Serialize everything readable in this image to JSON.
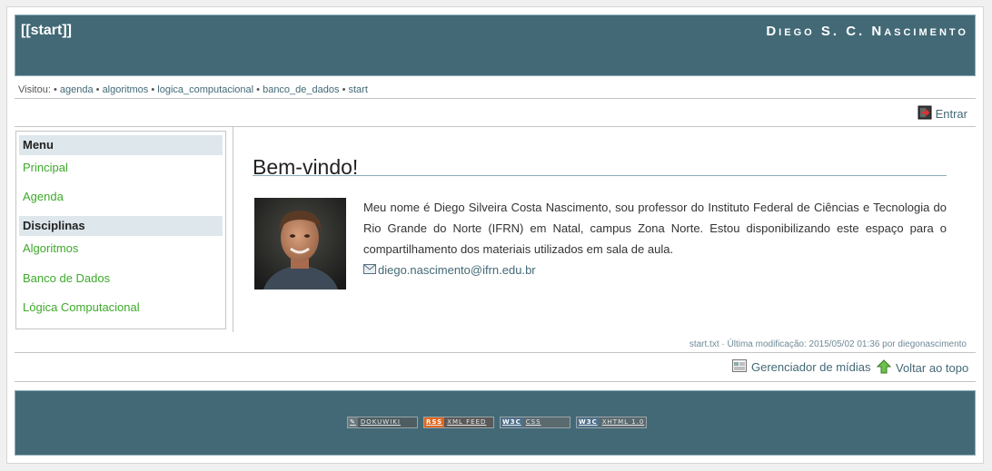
{
  "header": {
    "site_link": "[[start]]",
    "author_name": "Diego S. C. Nascimento"
  },
  "breadcrumbs": {
    "label": "Visitou:",
    "items": [
      "agenda",
      "algoritmos",
      "logica_computacional",
      "banco_de_dados",
      "start"
    ]
  },
  "user_tools": {
    "login": "Entrar"
  },
  "sidebar": {
    "menu_heading": "Menu",
    "menu_items": [
      "Principal",
      "Agenda"
    ],
    "disciplines_heading": "Disciplinas",
    "discipline_items": [
      "Algoritmos",
      "Banco de Dados",
      "Lógica Computacional"
    ]
  },
  "content": {
    "title": "Bem-vindo!",
    "intro": "Meu nome é Diego Silveira Costa Nascimento, sou professor do Instituto Federal de Ciências e Tecnologia do Rio Grande do Norte (IFRN) em Natal, campus Zona Norte. Estou disponibilizando este espaço para o compartilhamento dos materiais utilizados em sala de aula.",
    "email": "diego.nascimento@ifrn.edu.br"
  },
  "doc_info": "start.txt · Última modificação: 2015/05/02 01:36 por diegonascimento",
  "footer_tools": {
    "media_manager": "Gerenciador de mídias",
    "back_to_top": "Voltar ao topo"
  },
  "badges": [
    {
      "tag": "",
      "label": "DOKUWIKI"
    },
    {
      "tag": "RSS",
      "label": "XML FEED"
    },
    {
      "tag": "W3C",
      "label": "CSS"
    },
    {
      "tag": "W3C",
      "label": "XHTML 1.0"
    }
  ],
  "colors": {
    "header_bg": "#436976",
    "link": "#436976",
    "sidebar_link": "#3daa2a",
    "sidebar_heading_bg": "#dee7ec"
  },
  "icons": {
    "login": "login-icon",
    "email": "email-icon",
    "media_manager": "media-manager-icon",
    "back_to_top": "arrow-up-icon"
  }
}
